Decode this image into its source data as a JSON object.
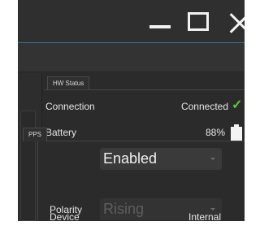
{
  "window": {
    "controls": {
      "minimize": "minimize-icon",
      "maximize": "maximize-icon",
      "close": "close-icon"
    }
  },
  "hw_status": {
    "tab_label": "HW Status",
    "connection": {
      "label": "Connection",
      "value": "Connected",
      "icon": "checkmark-icon",
      "icon_color": "#5ecb3c"
    },
    "battery": {
      "label": "Battery",
      "value": "88%",
      "icon": "battery-icon"
    }
  },
  "pps": {
    "tab_label": "PPS",
    "mode_select": {
      "value": "Enabled"
    },
    "polarity": {
      "label": "Polarity",
      "value": "Rising",
      "disabled": true
    },
    "device": {
      "label": "Device",
      "value": "Internal"
    }
  },
  "colors": {
    "accent": "#3b6e98",
    "background": "#2b2b2b",
    "text": "#e6e6e6"
  }
}
